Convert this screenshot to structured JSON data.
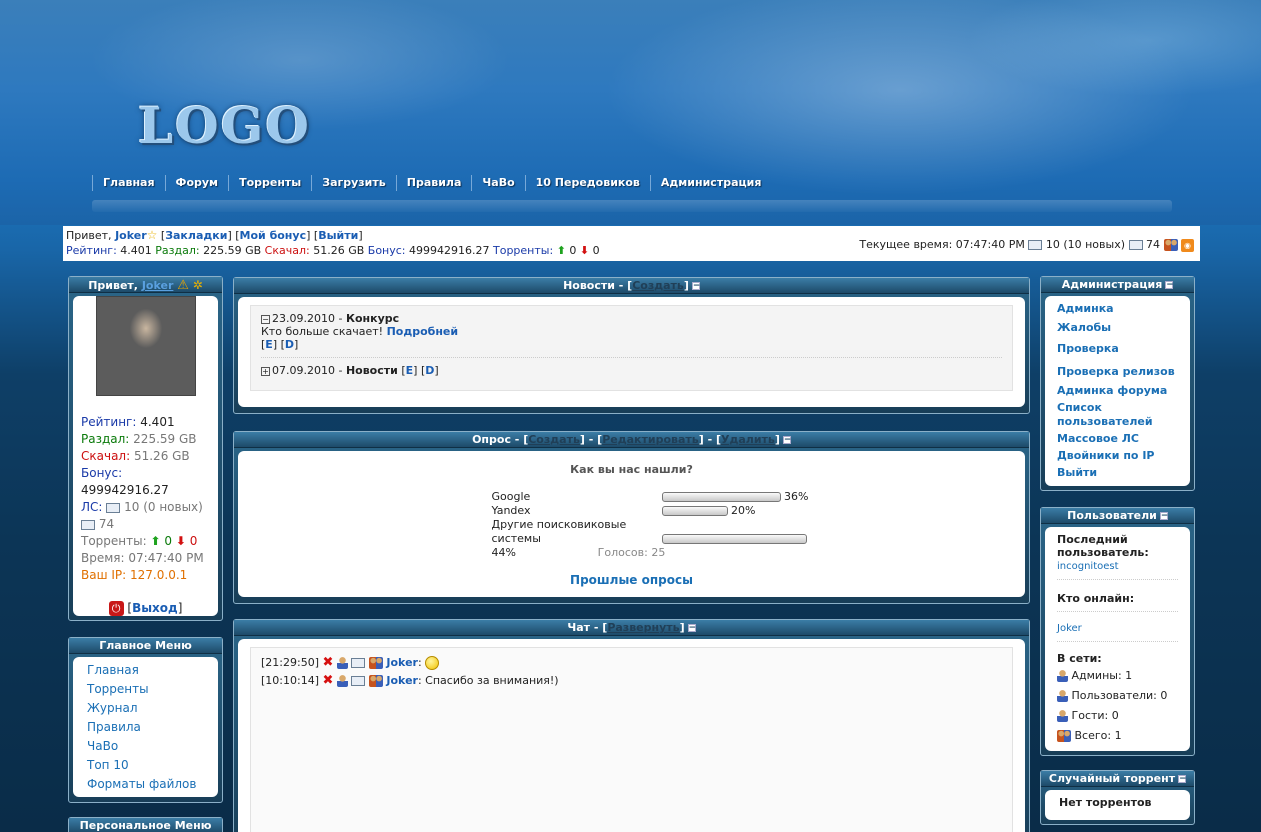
{
  "header": {
    "logo": "LOGO",
    "nav": [
      "Главная",
      "Форум",
      "Торренты",
      "Загрузить",
      "Правила",
      "ЧаВо",
      "10 Передовиков",
      "Администрация"
    ]
  },
  "userbar": {
    "greeting": "Привет,",
    "username": "Joker",
    "bookmarks": "Закладки",
    "bonus": "Мой бонус",
    "logout": "Выйти",
    "rating_label": "Рейтинг:",
    "rating": "4.401",
    "upload_label": "Раздал:",
    "upload": "225.59 GB",
    "download_label": "Скачал:",
    "download": "51.26 GB",
    "bonus_label": "Бонус:",
    "bonus_value": "499942916.27",
    "torrents_label": "Торренты:",
    "seeding": "0",
    "leeching": "0",
    "time_label": "Текущее время:",
    "time": "07:47:40 PM",
    "messages": "10 (10 новых)",
    "outbox": "74"
  },
  "left_user": {
    "greeting": "Привет,",
    "username": "Joker",
    "rating_label": "Рейтинг:",
    "rating": "4.401",
    "upload_label": "Раздал:",
    "upload": "225.59 GB",
    "download_label": "Скачал:",
    "download": "51.26 GB",
    "bonus_label": "Бонус:",
    "bonus": "499942916.27",
    "pm_label": "ЛС:",
    "pm": "10 (0 новых)",
    "outbox": "74",
    "torrents_label": "Торренты:",
    "seeding": "0",
    "leeching": "0",
    "time_label": "Время:",
    "time": "07:47:40 PM",
    "ip_label": "Ваш IP:",
    "ip": "127.0.0.1",
    "exit": "Выход"
  },
  "main_menu": {
    "title": "Главное Меню",
    "items": [
      "Главная",
      "Торренты",
      "Журнал",
      "Правила",
      "ЧаВо",
      "Топ 10",
      "Форматы файлов"
    ]
  },
  "personal_menu": {
    "title": "Персональное Меню"
  },
  "news": {
    "title": "Новости",
    "action": "Создать",
    "items": [
      {
        "date": "23.09.2010",
        "title": "Конкурс",
        "text": "Кто больше скачает!",
        "more": "Подробней",
        "edit": "E",
        "delete": "D"
      },
      {
        "date": "07.09.2010",
        "title": "Новости",
        "edit": "E",
        "delete": "D"
      }
    ]
  },
  "poll": {
    "title": "Опрос",
    "actions": [
      "Создать",
      "Редактировать",
      "Удалить"
    ],
    "question": "Как вы нас нашли?",
    "options": [
      {
        "label": "Google",
        "percent": 36,
        "percent_text": "36%"
      },
      {
        "label": "Yandex",
        "percent": 20,
        "percent_text": "20%"
      },
      {
        "label": "Другие поисковиковые системы",
        "percent": 44,
        "percent_text": "44%"
      }
    ],
    "votes": "Голосов: 25",
    "past": "Прошлые опросы"
  },
  "chat": {
    "title": "Чат",
    "action": "Развернуть",
    "messages": [
      {
        "time": "[21:29:50]",
        "user": "Joker",
        "text": ""
      },
      {
        "time": "[10:10:14]",
        "user": "Joker",
        "text": "Спасибо за внимания!)"
      }
    ]
  },
  "admin": {
    "title": "Администрация",
    "links": [
      "Админка",
      "Жалобы",
      "Проверка",
      "Проверка релизов",
      "Админка форума",
      "Список пользователей",
      "Массовое ЛС",
      "Двойники по IP",
      "Выйти"
    ]
  },
  "users": {
    "title": "Пользователи",
    "last_label": "Последний пользователь:",
    "last_user": "incognitoest",
    "online_label": "Кто онлайн:",
    "online_user": "Joker",
    "net_label": "В сети:",
    "admins": "Админы: 1",
    "users_count": "Пользователи: 0",
    "guests": "Гости: 0",
    "total": "Всего: 1"
  },
  "random_torrent": {
    "title": "Случайный торрент",
    "text": "Нет торрентов"
  },
  "colors": {
    "link": "#1a6fb5",
    "rating": "#1a3aa8",
    "upload": "#0a7a0a",
    "download": "#cc1010",
    "ip": "#e07000"
  }
}
